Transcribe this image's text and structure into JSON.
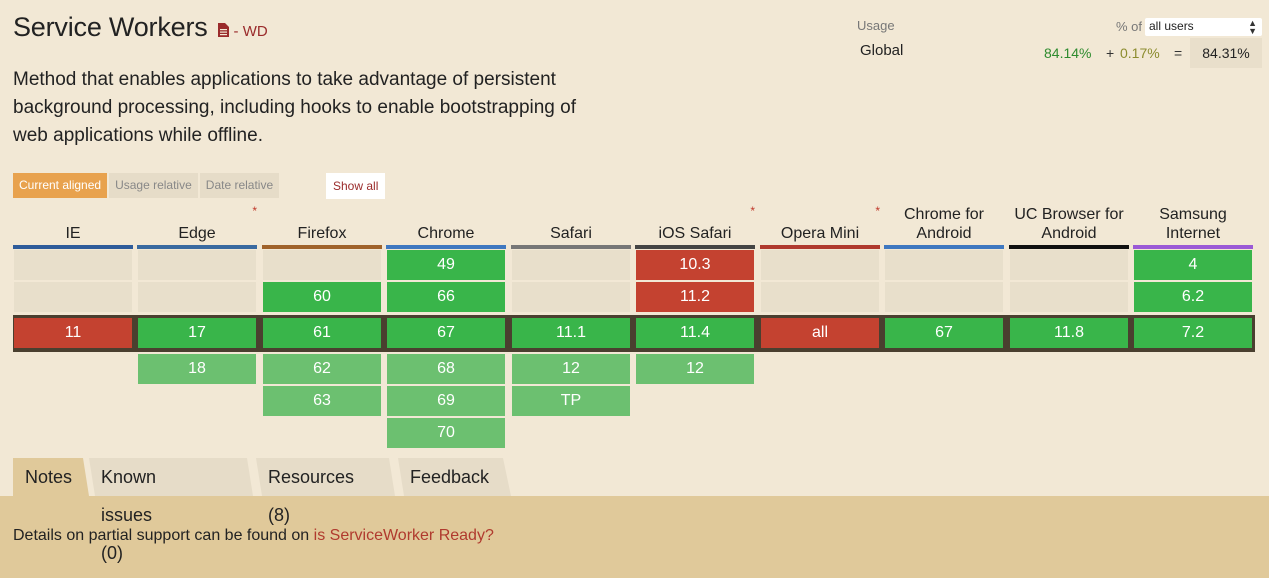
{
  "feature": {
    "title": "Service Workers",
    "status": "- WD",
    "description": "Method that enables applications to take advantage of persistent background processing, including hooks to enable bootstrapping of web applications while offline."
  },
  "usage": {
    "label": "Usage",
    "of_label": "% of",
    "select_value": "all users",
    "region": "Global",
    "full_support": "84.14%",
    "plus": "+",
    "partial_support": "0.17%",
    "equals": "=",
    "total": "84.31%"
  },
  "view_toggles": [
    "Current aligned",
    "Usage relative",
    "Date relative"
  ],
  "show_all": "Show all",
  "browsers": [
    {
      "name": "IE",
      "star": "",
      "bar_color": "#2f5c9a"
    },
    {
      "name": "Edge",
      "star": "*",
      "bar_color": "#3a6aa0"
    },
    {
      "name": "Firefox",
      "star": "",
      "bar_color": "#a0632b"
    },
    {
      "name": "Chrome",
      "star": "",
      "bar_color": "#3f78c0"
    },
    {
      "name": "Safari",
      "star": "",
      "bar_color": "#777777"
    },
    {
      "name": "iOS Safari",
      "star": "*",
      "bar_color": "#444444"
    },
    {
      "name": "Opera Mini",
      "star": "*",
      "bar_color": "#b03a2e"
    },
    {
      "name": "Chrome for Android",
      "star": "",
      "bar_color": "#3f78c0"
    },
    {
      "name": "UC Browser for Android",
      "star": "",
      "bar_color": "#111111"
    },
    {
      "name": "Samsung Internet",
      "star": "",
      "bar_color": "#9b59d6"
    }
  ],
  "rows": [
    [
      {
        "v": "",
        "s": "e"
      },
      {
        "v": "",
        "s": "e"
      },
      {
        "v": "",
        "s": "e"
      },
      {
        "v": "49",
        "s": "y"
      },
      {
        "v": "",
        "s": "e"
      },
      {
        "v": "10.3",
        "s": "n"
      },
      {
        "v": "",
        "s": "e"
      },
      {
        "v": "",
        "s": "e"
      },
      {
        "v": "",
        "s": "e"
      },
      {
        "v": "4",
        "s": "y"
      }
    ],
    [
      {
        "v": "",
        "s": "e"
      },
      {
        "v": "",
        "s": "e"
      },
      {
        "v": "60",
        "s": "y"
      },
      {
        "v": "66",
        "s": "y"
      },
      {
        "v": "",
        "s": "e"
      },
      {
        "v": "11.2",
        "s": "n"
      },
      {
        "v": "",
        "s": "e"
      },
      {
        "v": "",
        "s": "e"
      },
      {
        "v": "",
        "s": "e"
      },
      {
        "v": "6.2",
        "s": "y"
      }
    ],
    [
      {
        "v": "11",
        "s": "n"
      },
      {
        "v": "17",
        "s": "y"
      },
      {
        "v": "61",
        "s": "y"
      },
      {
        "v": "67",
        "s": "y"
      },
      {
        "v": "11.1",
        "s": "y"
      },
      {
        "v": "11.4",
        "s": "y"
      },
      {
        "v": "all",
        "s": "n"
      },
      {
        "v": "67",
        "s": "y"
      },
      {
        "v": "11.8",
        "s": "y"
      },
      {
        "v": "7.2",
        "s": "y"
      }
    ],
    [
      {
        "v": "",
        "s": ""
      },
      {
        "v": "18",
        "s": "f"
      },
      {
        "v": "62",
        "s": "f"
      },
      {
        "v": "68",
        "s": "f"
      },
      {
        "v": "12",
        "s": "f"
      },
      {
        "v": "12",
        "s": "f"
      },
      {
        "v": "",
        "s": ""
      },
      {
        "v": "",
        "s": ""
      },
      {
        "v": "",
        "s": ""
      },
      {
        "v": "",
        "s": ""
      }
    ],
    [
      {
        "v": "",
        "s": ""
      },
      {
        "v": "",
        "s": ""
      },
      {
        "v": "63",
        "s": "f"
      },
      {
        "v": "69",
        "s": "f"
      },
      {
        "v": "TP",
        "s": "f"
      },
      {
        "v": "",
        "s": ""
      },
      {
        "v": "",
        "s": ""
      },
      {
        "v": "",
        "s": ""
      },
      {
        "v": "",
        "s": ""
      },
      {
        "v": "",
        "s": ""
      }
    ],
    [
      {
        "v": "",
        "s": ""
      },
      {
        "v": "",
        "s": ""
      },
      {
        "v": "",
        "s": ""
      },
      {
        "v": "70",
        "s": "f"
      },
      {
        "v": "",
        "s": ""
      },
      {
        "v": "",
        "s": ""
      },
      {
        "v": "",
        "s": ""
      },
      {
        "v": "",
        "s": ""
      },
      {
        "v": "",
        "s": ""
      },
      {
        "v": "",
        "s": ""
      }
    ]
  ],
  "tabs": [
    "Notes",
    "Known issues (0)",
    "Resources (8)",
    "Feedback"
  ],
  "notes": {
    "text": "Details on partial support can be found on ",
    "link": "is ServiceWorker Ready?"
  },
  "colors": {
    "supported": "#39b54a",
    "not_supported": "#c44230",
    "future_supported": "#6cc070",
    "accent": "#e8a24e",
    "status_red": "#9a2b2b"
  }
}
